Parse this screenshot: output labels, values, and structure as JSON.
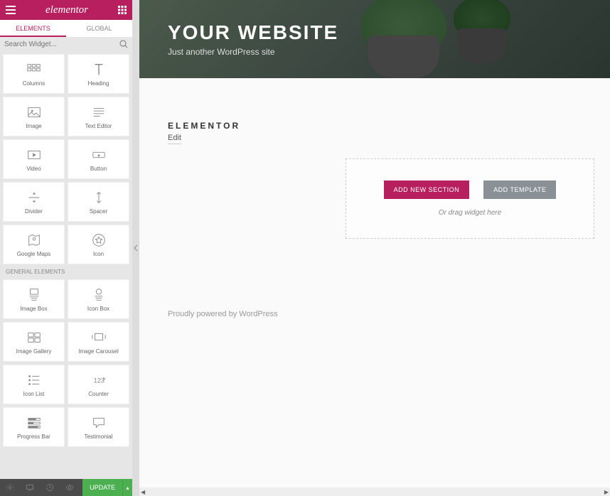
{
  "header": {
    "logo_text": "elementor"
  },
  "tabs": {
    "elements": "ELEMENTS",
    "global": "GLOBAL"
  },
  "search": {
    "placeholder": "Search Widget..."
  },
  "widgets_basic": [
    {
      "label": "Columns",
      "icon": "columns-icon"
    },
    {
      "label": "Heading",
      "icon": "heading-icon"
    },
    {
      "label": "Image",
      "icon": "image-icon"
    },
    {
      "label": "Text Editor",
      "icon": "text-editor-icon"
    },
    {
      "label": "Video",
      "icon": "video-icon"
    },
    {
      "label": "Button",
      "icon": "button-icon"
    },
    {
      "label": "Divider",
      "icon": "divider-icon"
    },
    {
      "label": "Spacer",
      "icon": "spacer-icon"
    },
    {
      "label": "Google Maps",
      "icon": "maps-icon"
    },
    {
      "label": "Icon",
      "icon": "star-icon"
    }
  ],
  "section_general": "GENERAL ELEMENTS",
  "widgets_general": [
    {
      "label": "Image Box",
      "icon": "image-box-icon"
    },
    {
      "label": "Icon Box",
      "icon": "icon-box-icon"
    },
    {
      "label": "Image Gallery",
      "icon": "gallery-icon"
    },
    {
      "label": "Image Carousel",
      "icon": "carousel-icon"
    },
    {
      "label": "Icon List",
      "icon": "icon-list-icon"
    },
    {
      "label": "Counter",
      "icon": "counter-icon"
    },
    {
      "label": "Progress Bar",
      "icon": "progress-icon"
    },
    {
      "label": "Testimonial",
      "icon": "testimonial-icon"
    }
  ],
  "footer": {
    "update": "UPDATE"
  },
  "hero": {
    "title": "YOUR WEBSITE",
    "subtitle": "Just another WordPress site"
  },
  "page": {
    "title": "ELEMENTOR",
    "edit": "Edit"
  },
  "drop": {
    "add_section": "ADD NEW SECTION",
    "add_template": "ADD TEMPLATE",
    "hint": "Or drag widget here"
  },
  "credits": "Proudly powered by WordPress"
}
